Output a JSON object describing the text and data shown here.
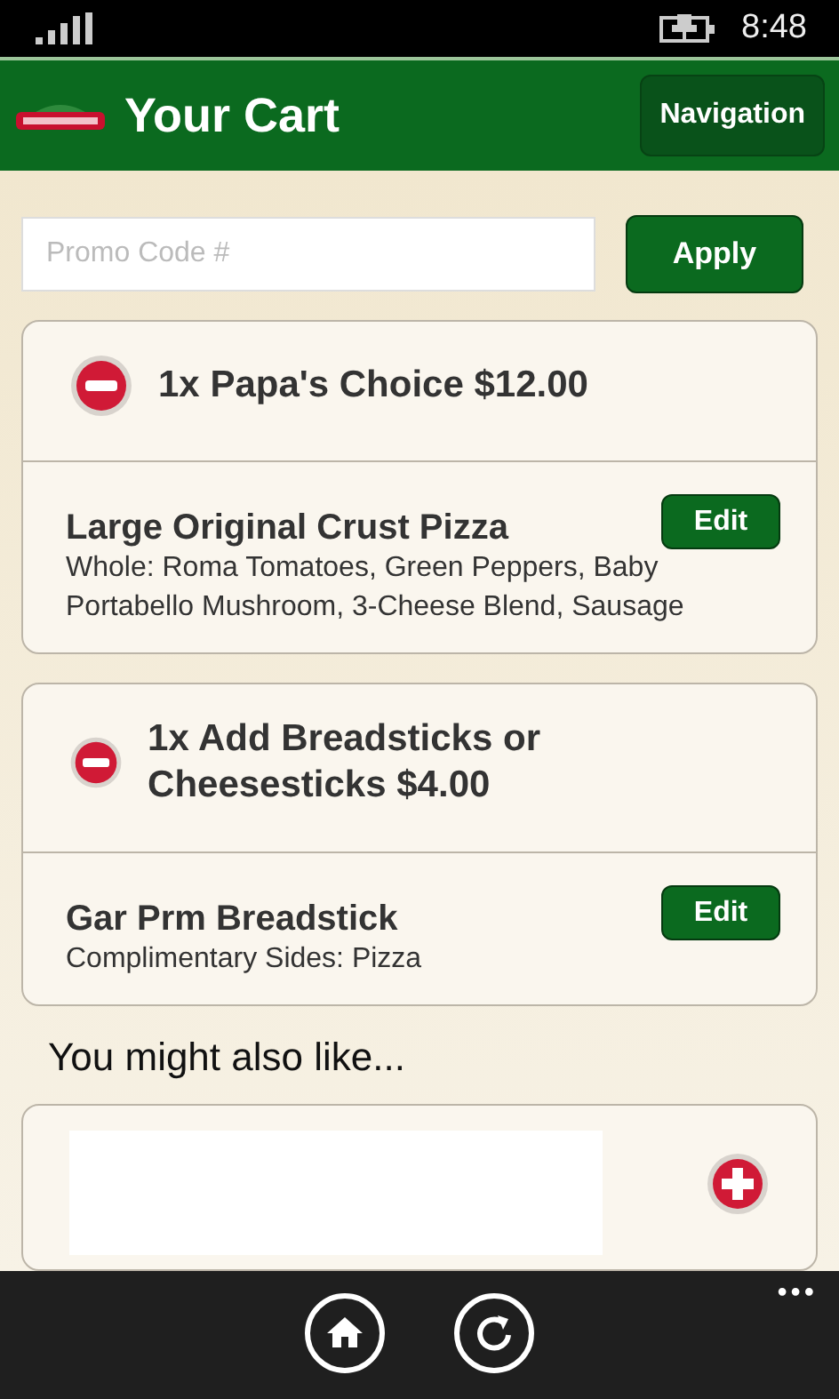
{
  "status_bar": {
    "time": "8:48"
  },
  "header": {
    "title": "Your Cart",
    "nav_button": "Navigation"
  },
  "promo": {
    "placeholder": "Promo Code #",
    "apply_button": "Apply"
  },
  "cart_items": [
    {
      "heading": "1x Papa's Choice $12.00",
      "product": "Large Original Crust Pizza",
      "details": "Whole: Roma Tomatoes, Green Peppers, Baby Portabello Mushroom, 3-Cheese Blend, Sausage",
      "edit_button": "Edit"
    },
    {
      "heading": "1x Add Breadsticks or Cheesesticks $4.00",
      "product": "Gar Prm Breadstick",
      "details": "Complimentary Sides: Pizza",
      "edit_button": "Edit"
    }
  ],
  "suggestions": {
    "title": "You might also like..."
  },
  "app_bar": {
    "more": "•••"
  }
}
